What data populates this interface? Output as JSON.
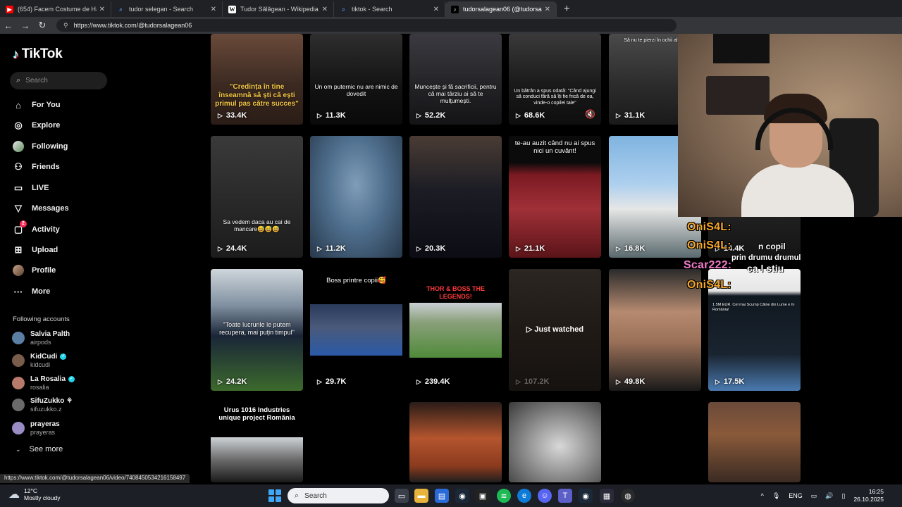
{
  "browser": {
    "tabs": [
      {
        "label": "(654) Facem Costume de Hallowe",
        "favicon": "youtube-icon",
        "color": "#ff0000"
      },
      {
        "label": "tudor selegan - Search",
        "favicon": "search-icon",
        "color": "#4c8bf5"
      },
      {
        "label": "Tudor Sălăgean - Wikipedia",
        "favicon": "wikipedia-icon",
        "color": "#ffffff"
      },
      {
        "label": "tiktok - Search",
        "favicon": "search-icon",
        "color": "#4c8bf5"
      },
      {
        "label": "tudorsalagean06 (@tudorsalage",
        "favicon": "tiktok-icon",
        "color": "#000000"
      }
    ],
    "new_tab": "+",
    "url": "https://www.tiktok.com/@tudorsalagean06",
    "status_url": "https://www.tiktok.com/@tudorsalagean06/video/7408450534216158497"
  },
  "sidebar": {
    "logo": "TikTok",
    "search_placeholder": "Search",
    "nav": [
      {
        "label": "For You",
        "icon": "home-icon"
      },
      {
        "label": "Explore",
        "icon": "compass-icon"
      },
      {
        "label": "Following",
        "icon": "following-avatar-icon"
      },
      {
        "label": "Friends",
        "icon": "friends-icon"
      },
      {
        "label": "LIVE",
        "icon": "live-icon"
      },
      {
        "label": "Messages",
        "icon": "messages-icon"
      },
      {
        "label": "Activity",
        "icon": "activity-icon",
        "badge": "2"
      },
      {
        "label": "Upload",
        "icon": "upload-icon"
      },
      {
        "label": "Profile",
        "icon": "profile-avatar-icon"
      },
      {
        "label": "More",
        "icon": "more-icon"
      }
    ],
    "following_title": "Following accounts",
    "accounts": [
      {
        "name": "Salvia Palth",
        "handle": "airpods",
        "verified": false,
        "color": "#5b7fa3"
      },
      {
        "name": "KidCudi",
        "handle": "kidcudi",
        "verified": true,
        "color": "#7a5c4a"
      },
      {
        "name": "La Rosalia",
        "handle": "rosalia",
        "verified": true,
        "color": "#b87a6a"
      },
      {
        "name": "SifuZukko ⚘",
        "handle": "sifuzukko.z",
        "verified": false,
        "color": "#6a6a6a"
      },
      {
        "name": "prayeras",
        "handle": "prayeras",
        "verified": false,
        "color": "#9a8cc4"
      }
    ],
    "see_more": "See more"
  },
  "videos": [
    {
      "views": "33.4K",
      "caption": "\"Credința în tine înseamnă să ști că ești primul pas către succes\"",
      "style": "yellow"
    },
    {
      "views": "11.3K",
      "caption": "Un om puternic nu are nimic de dovedit",
      "style": "white"
    },
    {
      "views": "52.2K",
      "caption": "Muncește și fă sacrificii, pentru că mai târziu ai să te mulțumești.",
      "style": "white"
    },
    {
      "views": "68.6K",
      "caption": "Un bătrân a spus odată: \"Când ajungi să conduci fără să îți fie frică de ea, vinde-o copilei tale\"",
      "style": "white"
    },
    {
      "views": "31.1K",
      "caption": "Să nu te pierzi în ochii altora",
      "style": "white"
    },
    {
      "views": "24.4K",
      "caption": "Sa vedem daca au cai de mancare😅😅😅",
      "style": "white"
    },
    {
      "views": "11.2K",
      "caption": "",
      "style": "white"
    },
    {
      "views": "20.3K",
      "caption": "",
      "style": "white"
    },
    {
      "views": "21.1K",
      "caption": "te-au auzit când nu ai spus nici un cuvânt!",
      "style": "white"
    },
    {
      "views": "16.8K",
      "caption": "",
      "style": "white"
    },
    {
      "views": "14.4K",
      "caption": "",
      "style": "white"
    },
    {
      "views": "24.2K",
      "caption": "\"Toate lucrurile le putem recupera, mai puțin timpul\"",
      "style": "white"
    },
    {
      "views": "29.7K",
      "caption": "Boss printre copii🥰",
      "style": "white"
    },
    {
      "views": "239.4K",
      "caption": "THOR & BOSS THE LEGENDS!",
      "style": "red"
    },
    {
      "views": "107.2K",
      "caption": "",
      "style": "white",
      "watched": "Just watched"
    },
    {
      "views": "49.8K",
      "caption": "",
      "style": "white"
    },
    {
      "views": "17.5K",
      "caption": "1.5M EUR. Cel mai Scump Câine din Lume e în România!",
      "style": "white"
    },
    {
      "views": "",
      "caption": "Urus 1016 Industries unique project România",
      "style": "white"
    },
    {
      "views": "",
      "caption": "",
      "style": "white"
    },
    {
      "views": "",
      "caption": "",
      "style": "white"
    },
    {
      "views": "",
      "caption": "",
      "style": "white"
    }
  ],
  "overlay": {
    "lines": [
      "OniS4L:",
      "OniS4L:",
      "Scar222:",
      "OniS4L:"
    ],
    "side_text": [
      "n copil",
      "prin drumu drumul",
      "ca l stiu"
    ]
  },
  "taskbar": {
    "temperature": "12°C",
    "weather": "Mostly cloudy",
    "search": "Search",
    "language": "ENG",
    "time": "16:25",
    "date": "26.10.2025"
  }
}
